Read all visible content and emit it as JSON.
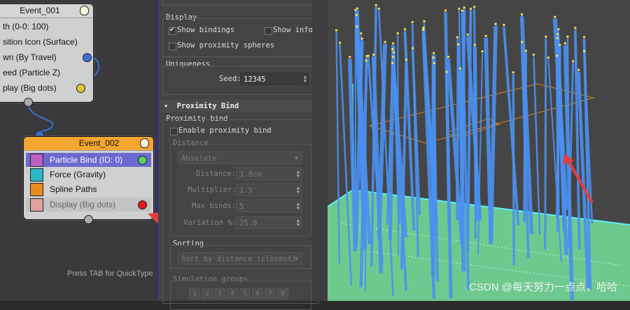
{
  "particle_view": {
    "event1": {
      "title": "Event_001",
      "rows": [
        "th (0-0: 100)",
        "sition Icon (Surface)",
        "wn (By Travel)",
        "eed (Particle Z)",
        "play (Big dots)"
      ]
    },
    "event2": {
      "title": "Event_002",
      "rows": [
        {
          "label": "Particle Bind (ID: 0)",
          "icon": "particle-bind-icon"
        },
        {
          "label": "Force (Gravity)",
          "icon": "force-icon"
        },
        {
          "label": "Spline Paths",
          "icon": "spline-paths-icon"
        },
        {
          "label": "Display (Big dots)",
          "icon": "display-icon"
        }
      ]
    },
    "hint": "Press TAB for QuickType"
  },
  "rollout": {
    "display": {
      "title": "Display",
      "show_bindings": "Show bindings",
      "show_info": "Show info",
      "show_proximity_spheres": "Show proximity spheres"
    },
    "uniqueness": {
      "title": "Uniqueness",
      "seed_label": "Seed:",
      "seed_value": "12345"
    },
    "proximity_bind": {
      "section_title": "Proximity Bind",
      "toggle": "▾",
      "group_title": "Proximity bind",
      "enable_label": "Enable proximity bind",
      "distance_title": "Distance",
      "mode_value": "Absolute",
      "distance_label": "Distance:",
      "distance_value": "3.0cm",
      "multiplier_label": "Multiplier:",
      "multiplier_value": "1.5",
      "max_binds_label": "Max binds:",
      "max_binds_value": "5",
      "variation_label": "Variation %:",
      "variation_value": "25.0",
      "sorting_title": "Sorting",
      "sorting_value": "Sort by distance (closest)",
      "sim_groups_title": "Simulation groups",
      "sim_groups": [
        "1",
        "2",
        "3",
        "4",
        "5",
        "6",
        "7",
        "8"
      ]
    }
  },
  "viewport": {
    "watermark": "CSDN @每天努力一点点，哈哈"
  },
  "colors": {
    "event_header_orange": "#f3a632",
    "selected_row": "#6a6ad0",
    "particle_blue": "#4a90f0",
    "particle_dot": "#f0e060",
    "ground_green": "#6ec98e",
    "box_cyan": "#5ef0ff",
    "arrow_red": "#e04040"
  }
}
